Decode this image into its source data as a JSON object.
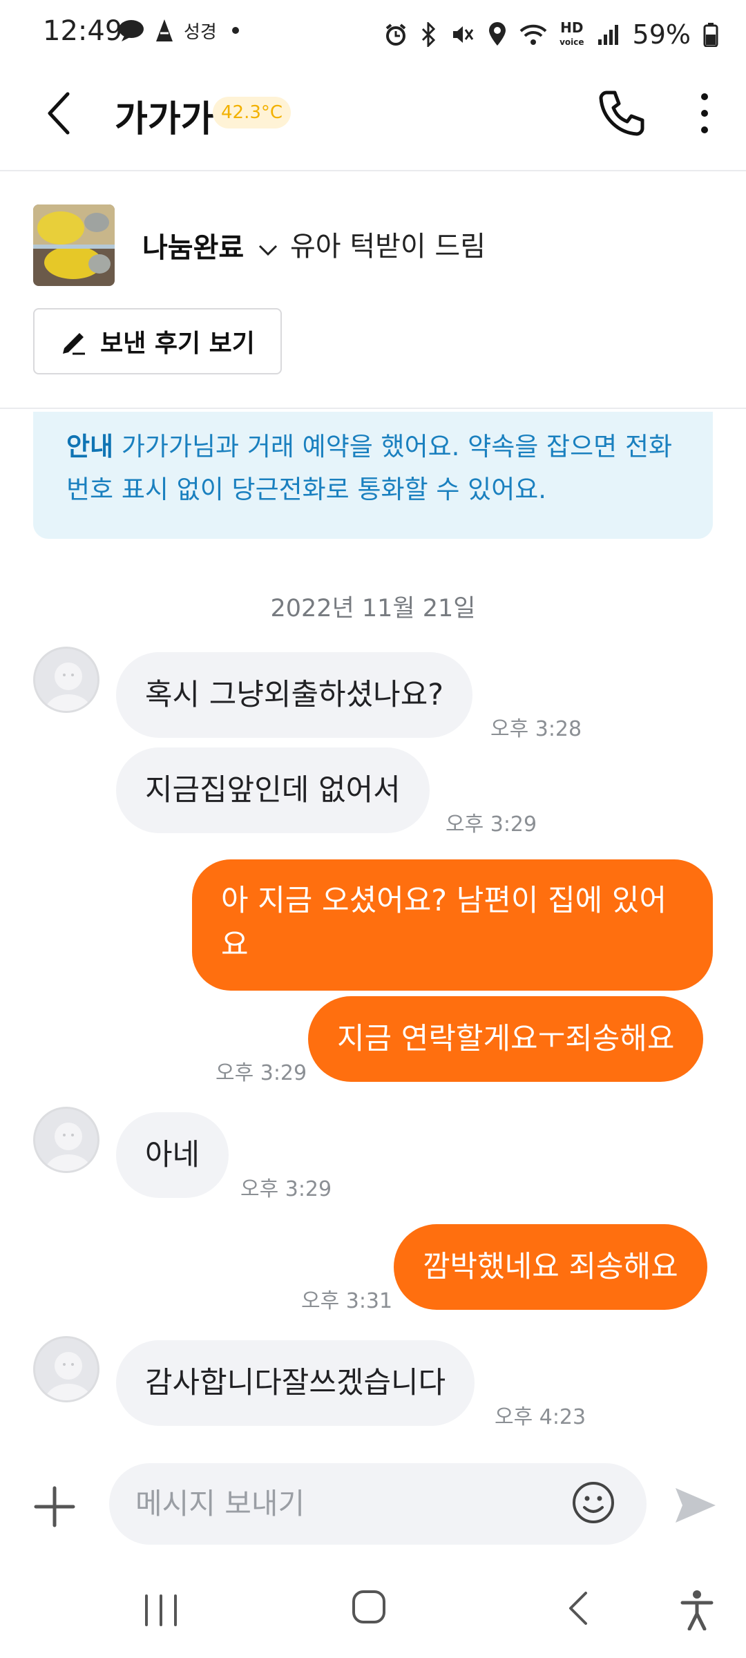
{
  "status_bar": {
    "time": "12:49",
    "carrier_label": "성경",
    "battery": "59%",
    "icons": [
      "alarm-icon",
      "bluetooth-icon",
      "mute-icon",
      "location-icon",
      "wifi-icon",
      "hd-voice-icon",
      "signal-icon",
      "battery-icon"
    ]
  },
  "header": {
    "title": "가가가",
    "temperature": "42.3°C",
    "icons": [
      "back-arrow-icon",
      "phone-icon",
      "more-vertical-icon"
    ]
  },
  "product": {
    "status": "나눔완료",
    "name": "유아 턱받이 드림",
    "review_button": "보낸 후기 보기"
  },
  "notice": {
    "label": "안내",
    "text": " 가가가님과 거래 예약을 했어요. 약속을 잡으면 전화번호 표시 없이 당근전화로 통화할 수 있어요."
  },
  "date": "2022년 11월 21일",
  "messages": [
    {
      "from": "other",
      "text": "혹시 그냥외출하셨나요?",
      "time": "오후 3:28"
    },
    {
      "from": "other",
      "text": "지금집앞인데 없어서",
      "time": "오후 3:29"
    },
    {
      "from": "me",
      "text": "아 지금 오셨어요? 남편이 집에 있어요",
      "time": ""
    },
    {
      "from": "me",
      "text": "지금 연락할게요ㅜ죄송해요",
      "time": "오후 3:29"
    },
    {
      "from": "other",
      "text": "아네",
      "time": "오후 3:29"
    },
    {
      "from": "me",
      "text": "깜박했네요 죄송해요",
      "time": "오후 3:31"
    },
    {
      "from": "other",
      "text": "감사합니다잘쓰겠습니다",
      "time": "오후 4:23"
    }
  ],
  "composer": {
    "placeholder": "메시지 보내기"
  },
  "colors": {
    "accent": "#ff6f0f",
    "notice_bg": "#e6f4fa",
    "notice_text": "#1a80bf",
    "temperature": "#f2b100"
  }
}
